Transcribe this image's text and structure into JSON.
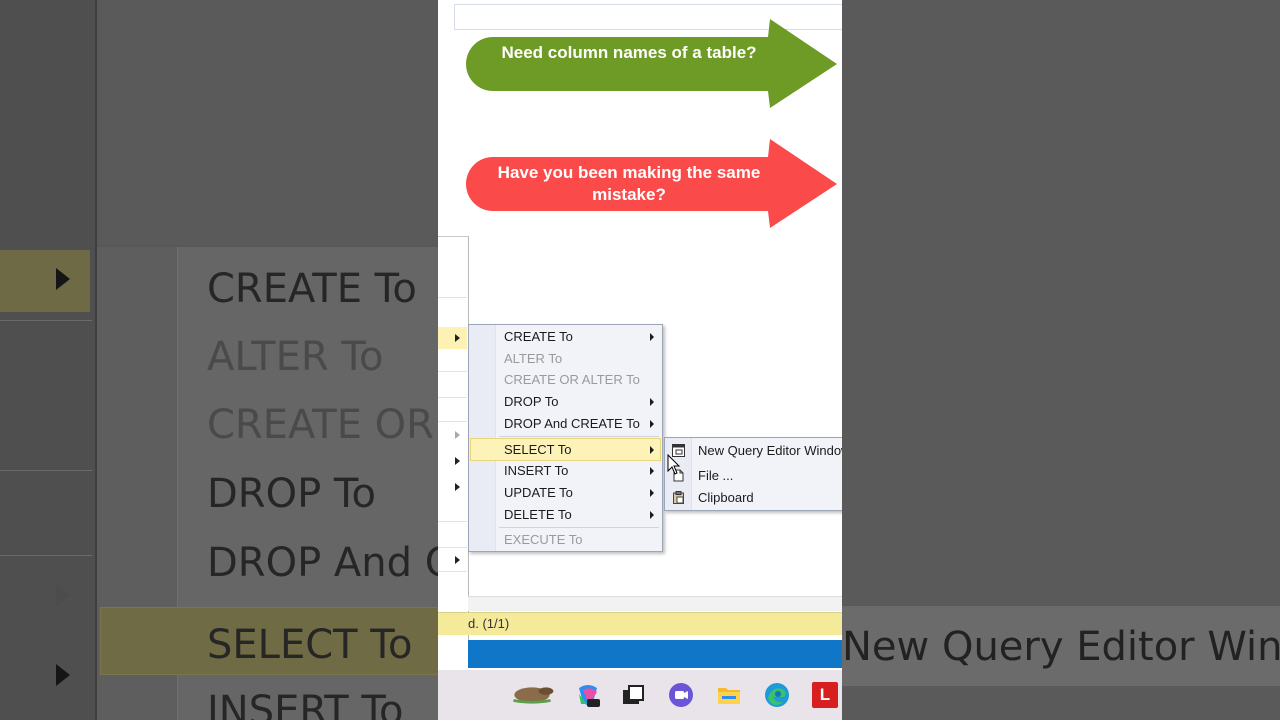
{
  "callouts": {
    "green": "Need column names of a table?",
    "red": "Have you been making the same mistake?"
  },
  "colors": {
    "green_arrow": "#6e9a26",
    "red_arrow": "#fa4a4a",
    "highlight": "#fdf3b9",
    "menu_bg": "#f1f3f9",
    "status_bar": "#f5e99a",
    "blue_bar": "#0f76c8"
  },
  "context_menu": {
    "items": [
      {
        "label": "CREATE To",
        "disabled": false,
        "submenu": true
      },
      {
        "label": "ALTER To",
        "disabled": true,
        "submenu": false
      },
      {
        "label": "CREATE OR ALTER To",
        "disabled": true,
        "submenu": false
      },
      {
        "label": "DROP To",
        "disabled": false,
        "submenu": true
      },
      {
        "label": "DROP And CREATE To",
        "disabled": false,
        "submenu": true
      },
      {
        "label": "SELECT To",
        "disabled": false,
        "submenu": true,
        "active": true
      },
      {
        "label": "INSERT To",
        "disabled": false,
        "submenu": true
      },
      {
        "label": "UPDATE To",
        "disabled": false,
        "submenu": true
      },
      {
        "label": "DELETE To",
        "disabled": false,
        "submenu": true
      },
      {
        "label": "EXECUTE To",
        "disabled": true,
        "submenu": false
      }
    ]
  },
  "select_submenu": {
    "items": [
      {
        "label": "New Query Editor Window",
        "icon": "new-query-window-icon"
      },
      {
        "label": "File ...",
        "icon": "file-icon"
      },
      {
        "label": "Clipboard",
        "icon": "clipboard-icon"
      }
    ]
  },
  "status": {
    "text": "d. (1/1)"
  },
  "background_zoom": {
    "items": [
      "CREATE To",
      "ALTER To",
      "CREATE OR A",
      "DROP To",
      "DROP And C",
      "SELECT To",
      "INSERT To"
    ],
    "right_text": "New Query Editor Window"
  },
  "taskbar": {
    "icons": [
      "platypus-widget-icon",
      "copilot-icon",
      "task-view-icon",
      "teams-icon",
      "file-explorer-icon",
      "edge-icon",
      "lastpass-icon"
    ],
    "lastpass_label": "L"
  }
}
